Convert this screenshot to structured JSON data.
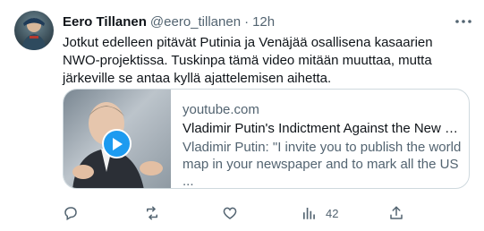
{
  "author": {
    "name": "Eero Tillanen",
    "handle": "@eero_tillanen",
    "separator": "·",
    "time": "12h"
  },
  "tweet": {
    "text": "Jotkut edelleen pitävät Putinia ja Venäjää osallisena kasaarien NWO-projektissa. Tuskinpa tämä video mitään muuttaa, mutta järkeville se antaa kyllä ajattelemisen aihetta."
  },
  "card": {
    "domain": "youtube.com",
    "title": "Vladimir Putin's Indictment Against the New World ...",
    "description": "Vladimir Putin: \"I invite you to publish the world map in your newspaper and to mark all the US ..."
  },
  "actions": {
    "reply_count": "",
    "retweet_count": "",
    "like_count": "",
    "views_count": "42"
  },
  "icons": {
    "more": "more-horizontal-icon",
    "reply": "reply-icon",
    "retweet": "retweet-icon",
    "like": "heart-icon",
    "views": "views-bar-chart-icon",
    "share": "share-icon",
    "play": "play-icon"
  },
  "colors": {
    "text_primary": "#0f1419",
    "text_secondary": "#536471",
    "accent": "#1d9bf0",
    "border": "#cfd9de"
  }
}
